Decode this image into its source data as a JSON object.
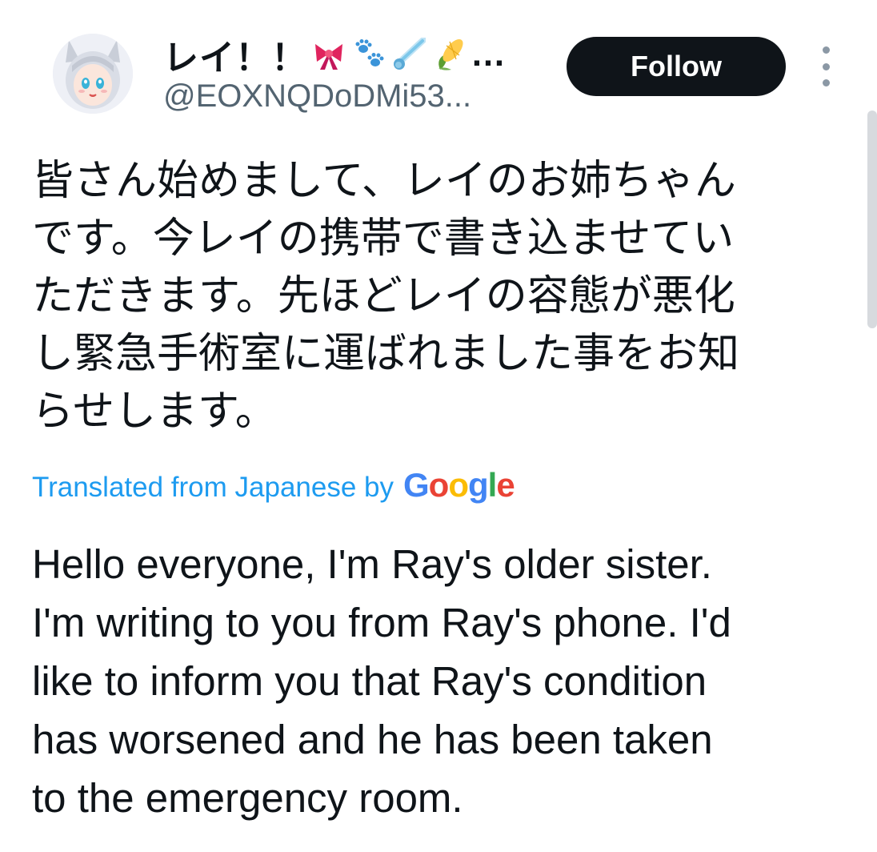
{
  "user": {
    "display_name": "レイ！！",
    "name_emojis": [
      "ribbon",
      "paw-prints",
      "comet",
      "corn"
    ],
    "name_ellipsis": "…",
    "handle": "@EOXNQDoDMi53..."
  },
  "actions": {
    "follow_label": "Follow",
    "more_icon": "more-vertical-icon"
  },
  "post": {
    "original_text": "皆さん始めまして、レイのお姉ちゃん\nです。今レイの携帯で書き込ませてい\nただきます。先ほどレイの容態が悪化\nし緊急手術室に運ばれました事をお知\nらせします。",
    "translation_label": "Translated from Japanese by",
    "translation_provider": "Google",
    "translated_text": "Hello everyone, I'm Ray's older sister.\nI'm writing to you from Ray's phone. I'd\nlike to inform you that Ray's condition\nhas worsened and he has been taken\nto the emergency room."
  },
  "colors": {
    "text": "#0f1419",
    "secondary": "#536471",
    "link": "#1d9bf0",
    "button_bg": "#0f1419",
    "google_blue": "#4285f4",
    "google_red": "#ea4335",
    "google_yellow": "#fbbc05",
    "google_green": "#34a853"
  }
}
